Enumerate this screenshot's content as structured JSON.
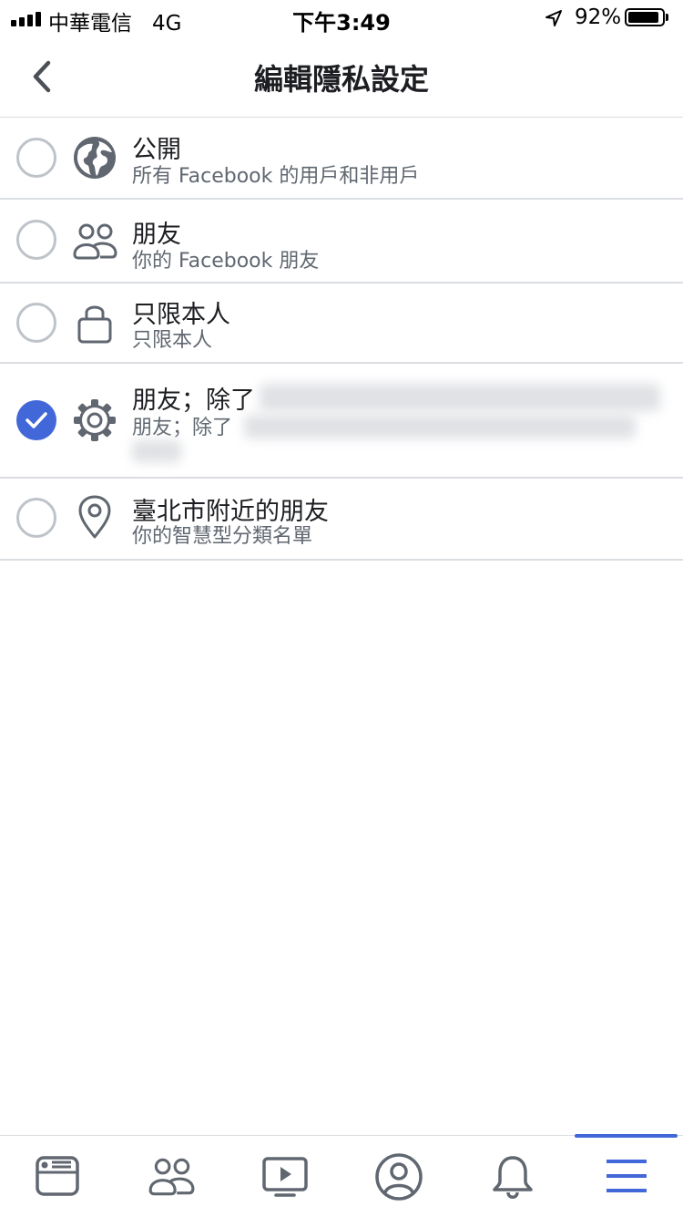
{
  "status_bar": {
    "carrier": "中華電信",
    "network": "4G",
    "time": "下午3:49",
    "battery_percent": "92%",
    "battery_level": 0.92
  },
  "header": {
    "title": "編輯隱私設定",
    "back_icon": "chevron-left-icon"
  },
  "options": [
    {
      "title": "公開",
      "subtitle": "所有 Facebook 的用戶和非用戶",
      "icon": "globe-icon",
      "selected": false
    },
    {
      "title": "朋友",
      "subtitle": "你的 Facebook 朋友",
      "icon": "friends-icon",
      "selected": false
    },
    {
      "title": "只限本人",
      "subtitle": "只限本人",
      "icon": "lock-icon",
      "selected": false
    },
    {
      "title": "朋友；除了",
      "subtitle": "朋友；除了",
      "icon": "gear-icon",
      "selected": true
    },
    {
      "title": "臺北市附近的朋友",
      "subtitle": "你的智慧型分類名單",
      "icon": "location-pin-icon",
      "selected": false
    }
  ],
  "tabs": [
    {
      "name": "news-feed",
      "icon": "news-feed-icon"
    },
    {
      "name": "friends",
      "icon": "friends-icon"
    },
    {
      "name": "watch",
      "icon": "video-icon"
    },
    {
      "name": "profile",
      "icon": "profile-icon"
    },
    {
      "name": "notifications",
      "icon": "bell-icon"
    },
    {
      "name": "menu",
      "icon": "menu-icon",
      "active": true
    }
  ],
  "colors": {
    "accent": "#4267d8",
    "divider": "#dadde1",
    "text_primary": "#1c1e21",
    "text_secondary": "#606770",
    "icon": "#606770"
  }
}
